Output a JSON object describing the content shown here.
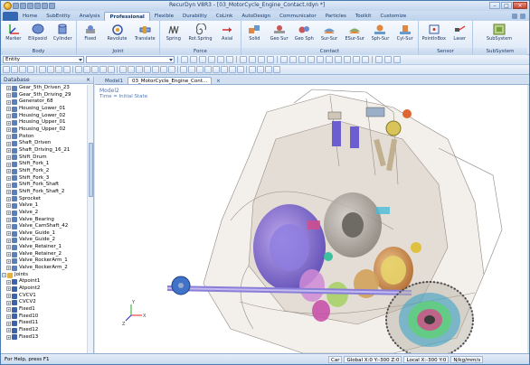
{
  "window": {
    "title": "RecurDyn V8R3 - [03_MotorCycle_Engine_Contact.rdyn *]",
    "controls": [
      "–",
      "□",
      "×"
    ]
  },
  "ribbon_tabs": [
    "Home",
    "SubEntity",
    "Analysis",
    "Professional",
    "Flexible",
    "Durability",
    "CoLink",
    "AutoDesign",
    "Communicator",
    "Particles",
    "Toolkit",
    "Customize"
  ],
  "active_tab": "Professional",
  "ribbon_groups": [
    {
      "name": "Body",
      "buttons": [
        "Marker",
        "Ellipsoid",
        "Cylinder"
      ]
    },
    {
      "name": "Joint",
      "buttons": [
        "Fixed",
        "Revolute",
        "Translate"
      ]
    },
    {
      "name": "Force",
      "buttons": [
        "Spring",
        "Rot.Spring",
        "Axial"
      ]
    },
    {
      "name": "Contact",
      "buttons": [
        "Solid",
        "Geo Sur",
        "Geo Sph",
        "Sur-Sur",
        "ESur-Sur",
        "Sph-Sur",
        "Cyl-Sur"
      ]
    },
    {
      "name": "Sensor",
      "buttons": [
        "PointInBox",
        "Laser"
      ]
    },
    {
      "name": "SubSystem",
      "buttons": [
        "SubSystem"
      ]
    }
  ],
  "toolbar": {
    "entity_combo": "Entity"
  },
  "database": {
    "title": "Database",
    "items": [
      {
        "label": "Gear_5th_Driven_23",
        "type": "body"
      },
      {
        "label": "Gear_5th_Driving_29",
        "type": "body"
      },
      {
        "label": "Generator_68",
        "type": "body"
      },
      {
        "label": "Housing_Lower_01",
        "type": "body"
      },
      {
        "label": "Housing_Lower_02",
        "type": "body"
      },
      {
        "label": "Housing_Upper_01",
        "type": "body"
      },
      {
        "label": "Housing_Upper_02",
        "type": "body"
      },
      {
        "label": "Piston",
        "type": "body"
      },
      {
        "label": "Shaft_Driven",
        "type": "body"
      },
      {
        "label": "Shaft_Driving_16_21",
        "type": "body"
      },
      {
        "label": "Shift_Drum",
        "type": "body"
      },
      {
        "label": "Shift_Fork_1",
        "type": "body"
      },
      {
        "label": "Shift_Fork_2",
        "type": "body"
      },
      {
        "label": "Shift_Fork_3",
        "type": "body"
      },
      {
        "label": "Shift_Fork_Shaft",
        "type": "body"
      },
      {
        "label": "Shift_Fork_Shaft_2",
        "type": "body"
      },
      {
        "label": "Sprocket",
        "type": "body"
      },
      {
        "label": "Valve_1",
        "type": "body"
      },
      {
        "label": "Valve_2",
        "type": "body"
      },
      {
        "label": "Valve_Bearing",
        "type": "body"
      },
      {
        "label": "Valve_CamShaft_42",
        "type": "body"
      },
      {
        "label": "Valve_Guide_1",
        "type": "body"
      },
      {
        "label": "Valve_Guide_2",
        "type": "body"
      },
      {
        "label": "Valve_Retainer_1",
        "type": "body"
      },
      {
        "label": "Valve_Retainer_2",
        "type": "body"
      },
      {
        "label": "Valve_RockerArm_1",
        "type": "body"
      },
      {
        "label": "Valve_RockerArm_2",
        "type": "body"
      },
      {
        "label": "Joints",
        "type": "folder"
      },
      {
        "label": "Atpoint1",
        "type": "joint"
      },
      {
        "label": "Atpoint2",
        "type": "joint"
      },
      {
        "label": "CVCV1",
        "type": "joint"
      },
      {
        "label": "CVCV2",
        "type": "joint"
      },
      {
        "label": "Fixed1",
        "type": "joint"
      },
      {
        "label": "Fixed10",
        "type": "joint"
      },
      {
        "label": "Fixed11",
        "type": "joint"
      },
      {
        "label": "Fixed12",
        "type": "joint"
      },
      {
        "label": "Fixed13",
        "type": "joint"
      }
    ]
  },
  "document_tabs": [
    "Model1",
    "03_MotorCycle_Engine_Cont..."
  ],
  "active_document": "03_MotorCycle_Engine_Cont...",
  "viewport": {
    "model_label": "Model2",
    "time_label": "Time  =  Initial State",
    "axis_labels": [
      "X",
      "Y",
      "Z"
    ]
  },
  "statusbar": {
    "help": "For Help, press F1",
    "fields": [
      "Car",
      "Global  X:0 Y:-300 Z:0",
      "Local  X:-300 Y:0",
      "N/kg/mm/s"
    ]
  },
  "colors": {
    "title_blue": "#1d3a63",
    "viewport_label": "#4f79b8",
    "ribbon_bg": "#dce8f6"
  }
}
